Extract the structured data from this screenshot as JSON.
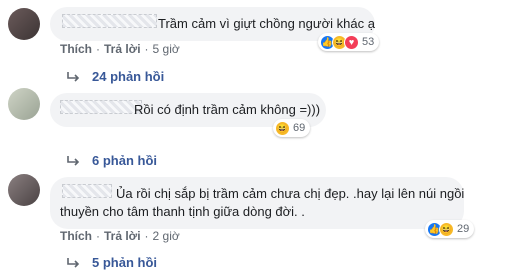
{
  "comments": [
    {
      "text": "Trầm cảm vì giựt chồng người khác ạ",
      "actions": {
        "like": "Thích",
        "reply": "Trả lời",
        "time": "5 giờ"
      },
      "reaction_count": "53",
      "replies_label": "24 phản hồi"
    },
    {
      "text": "Rồi có định trầm cảm không =)))",
      "reaction_count": "69",
      "replies_label": "6 phản hồi"
    },
    {
      "text_line1": "Ủa rồi chị sắp bị trầm cảm chưa chị đẹp. .hay lại lên núi ngồi",
      "text_line2": "thuyền cho tâm thanh tịnh giữa dòng đời. .",
      "actions": {
        "like": "Thích",
        "reply": "Trả lời",
        "time": "2 giờ"
      },
      "reaction_count": "29",
      "replies_label": "5 phản hồi"
    }
  ],
  "reaction_glyphs": {
    "like": "👍",
    "haha": "😆",
    "heart": "♥"
  },
  "colors": {
    "bubble": "#f2f3f5",
    "link": "#385898",
    "meta": "#606770",
    "like": "#1877f2",
    "haha": "#f7b928",
    "heart": "#f33e58"
  }
}
